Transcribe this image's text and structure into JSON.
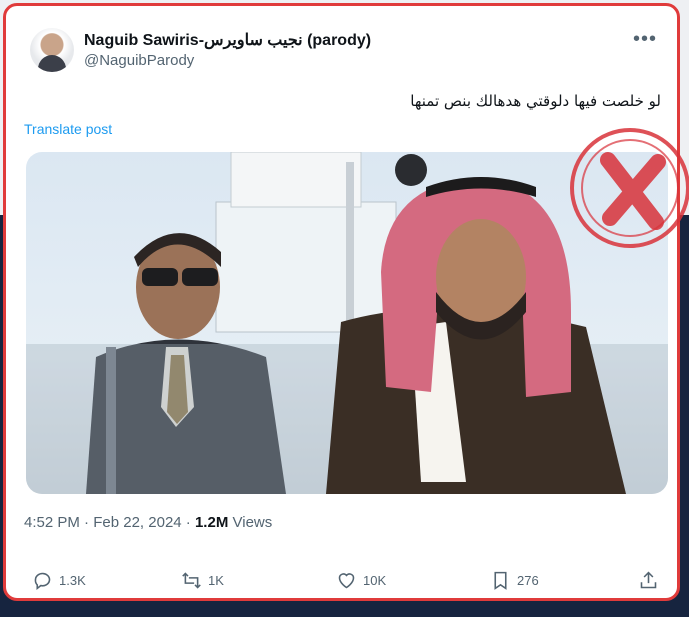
{
  "post": {
    "display_name": "Naguib Sawiris-نجيب ساويرس (parody)",
    "handle": "@NaguibParody",
    "text": "لو خلصت فيها دلوقتي هدهالك بنص تمنها",
    "translate_label": "Translate post",
    "time": "4:52 PM",
    "date": "Feb 22, 2024",
    "views_count": "1.2M",
    "views_label": "Views"
  },
  "actions": {
    "replies": "1.3K",
    "reposts": "1K",
    "likes": "10K",
    "bookmarks": "276"
  },
  "icons": [
    "avatar",
    "more-icon",
    "reply-icon",
    "repost-icon",
    "like-icon",
    "bookmark-icon",
    "share-icon"
  ],
  "colors": {
    "frame_border": "#e03b3b",
    "link": "#1d9bf0",
    "stamp": "#d8323a",
    "background_dark": "#16243f"
  }
}
